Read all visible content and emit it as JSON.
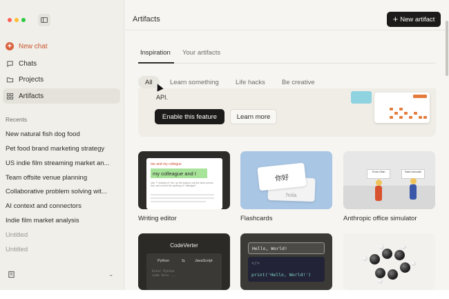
{
  "colors": {
    "accent": "#d9633f",
    "dark_button": "#1c1b19"
  },
  "sidebar": {
    "new_chat": "New chat",
    "items": [
      {
        "label": "Chats",
        "icon": "chat-bubble-icon"
      },
      {
        "label": "Projects",
        "icon": "folder-icon"
      },
      {
        "label": "Artifacts",
        "icon": "grid-icon"
      }
    ],
    "recents_title": "Recents",
    "recents": [
      "New natural fish dog food",
      "Pet food brand marketing strategy",
      "US indie film streaming market an...",
      "Team offsite venue planning",
      "Collaborative problem solving wit...",
      "AI context and connectors",
      "Indie film market analysis",
      "Untitled",
      "Untitled"
    ]
  },
  "header": {
    "title": "Artifacts",
    "new_artifact": "New artifact"
  },
  "tabs": [
    "Inspiration",
    "Your artifacts"
  ],
  "filters": [
    "All",
    "Learn something",
    "Life hacks",
    "Be creative"
  ],
  "banner": {
    "text": "API.",
    "enable": "Enable this feature",
    "learn_more": "Learn more"
  },
  "cards": [
    {
      "label": "Writing editor",
      "eyebrow": "me and my collegue",
      "highlight": "my colleague and I",
      "body": "Use \"I\" instead of \"me\" as the subject, put the other person first, and correct the spelling of \"colleague\""
    },
    {
      "label": "Flashcards",
      "front": "你好",
      "back": "hola"
    },
    {
      "label": "Anthropic office simulator",
      "board1": "Chris Olah",
      "board2": "Dario Amodei"
    },
    {
      "title": "CodeVerter",
      "from": "Python",
      "to": "JavaScript",
      "swap": "⇆",
      "placeholder_1": "Enter Python",
      "placeholder_2": "code here ..."
    },
    {
      "input": "Hello, World!",
      "tag": "</>",
      "code": "print('Hello, World!')"
    }
  ]
}
